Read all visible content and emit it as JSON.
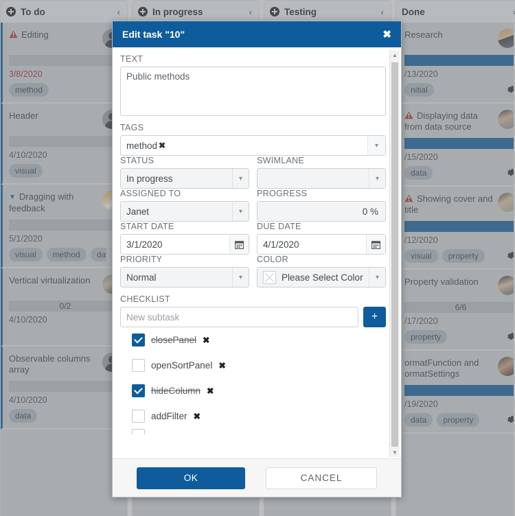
{
  "board": {
    "columns": [
      {
        "title": "To do",
        "add_icon": "plus-circle-icon",
        "collapse_icon": "chevron-left-icon",
        "collapse_glyph": "‹",
        "cards": [
          {
            "title": "Editing",
            "priority": "high",
            "avatar": "silhouette",
            "progress": 0,
            "progress_label": "",
            "date": "3/8/2020",
            "date_overdue": true,
            "tags": [
              "method"
            ]
          },
          {
            "title": "Header",
            "priority": "normal",
            "avatar": "silhouette",
            "progress": 0,
            "progress_label": "",
            "date": "4/10/2020",
            "date_overdue": false,
            "tags": [
              "visual"
            ]
          },
          {
            "title": "Dragging with feedback",
            "priority": "low",
            "avatar": "photo-b",
            "progress": 0,
            "progress_label": "",
            "date": "5/1/2020",
            "date_overdue": false,
            "tags": [
              "visual",
              "method",
              "data"
            ]
          },
          {
            "title": "Vertical virtualization",
            "priority": "normal",
            "avatar": "photo-c",
            "progress": 0,
            "progress_label": "0/2",
            "date": "4/10/2020",
            "date_overdue": false,
            "tags": []
          },
          {
            "title": "Observable columns array",
            "priority": "normal",
            "avatar": "silhouette",
            "progress": 0,
            "progress_label": "",
            "date": "4/10/2020",
            "date_overdue": false,
            "tags": [
              "data"
            ]
          }
        ]
      },
      {
        "title": "In progress",
        "add_icon": "plus-circle-icon",
        "collapse_icon": "chevron-left-icon",
        "collapse_glyph": "‹",
        "cards": []
      },
      {
        "title": "Testing",
        "add_icon": "plus-circle-icon",
        "collapse_icon": "chevron-left-icon",
        "collapse_glyph": "‹",
        "cards": []
      },
      {
        "title": "Done",
        "add_icon": "",
        "collapse_icon": "chevron-right-icon",
        "collapse_glyph": "›",
        "cards": [
          {
            "title": "Research",
            "priority": "normal",
            "avatar": "photo-a",
            "progress": 100,
            "progress_label": "",
            "date": "/13/2020",
            "date_overdue": false,
            "tags": [
              "nitial"
            ]
          },
          {
            "title": "Displaying data from data source",
            "priority": "high",
            "avatar": "photo-d",
            "progress": 100,
            "progress_label": "",
            "date": "/15/2020",
            "date_overdue": false,
            "tags": [
              "data"
            ]
          },
          {
            "title": "Showing cover and title",
            "priority": "high",
            "avatar": "photo-f",
            "progress": 100,
            "progress_label": "",
            "date": "/12/2020",
            "date_overdue": false,
            "tags": [
              "visual",
              "property"
            ]
          },
          {
            "title": "Property validation",
            "priority": "normal",
            "avatar": "photo-e",
            "progress": 0,
            "progress_label": "6/6",
            "date": "/17/2020",
            "date_overdue": false,
            "tags": [
              "property"
            ]
          },
          {
            "title": "ormatFunction and ormatSettings",
            "priority": "normal",
            "avatar": "photo-g",
            "progress": 100,
            "progress_label": "",
            "date": "/19/2020",
            "date_overdue": false,
            "tags": [
              "data",
              "property"
            ]
          }
        ]
      }
    ]
  },
  "modal": {
    "title": "Edit task \"10\"",
    "close_glyph": "✖",
    "fields": {
      "text_label": "TEXT",
      "text_value": "Public methods",
      "tags_label": "TAGS",
      "tags_values": [
        "method"
      ],
      "tags_remove_glyph": "✖",
      "status_label": "STATUS",
      "status_value": "In progress",
      "swimlane_label": "SWIMLANE",
      "swimlane_value": "",
      "assigned_label": "ASSIGNED TO",
      "assigned_value": "Janet",
      "progress_label": "PROGRESS",
      "progress_value": "0 %",
      "start_date_label": "START DATE",
      "start_date_value": "3/1/2020",
      "due_date_label": "DUE DATE",
      "due_date_value": "4/1/2020",
      "priority_label": "PRIORITY",
      "priority_value": "Normal",
      "color_label": "COLOR",
      "color_value": "Please Select Color",
      "checklist_label": "CHECKLIST",
      "new_subtask_placeholder": "New subtask",
      "add_button_glyph": "+"
    },
    "checklist": [
      {
        "text": "closePanel",
        "checked": true,
        "remove_glyph": "✖"
      },
      {
        "text": "openSortPanel",
        "checked": false,
        "remove_glyph": "✖"
      },
      {
        "text": "hideColumn",
        "checked": true,
        "remove_glyph": "✖"
      },
      {
        "text": "addFilter",
        "checked": false,
        "remove_glyph": "✖"
      }
    ],
    "footer": {
      "ok_label": "OK",
      "cancel_label": "CANCEL"
    },
    "scroll_up_glyph": "▲",
    "scroll_down_glyph": "▼"
  },
  "colors": {
    "accent": "#0f5c9c",
    "column_header_bg": "#eceff1",
    "column_body_bg": "#cfd3d6",
    "tag_bg": "#aeb8c2",
    "overdue": "#9d2c2c"
  }
}
